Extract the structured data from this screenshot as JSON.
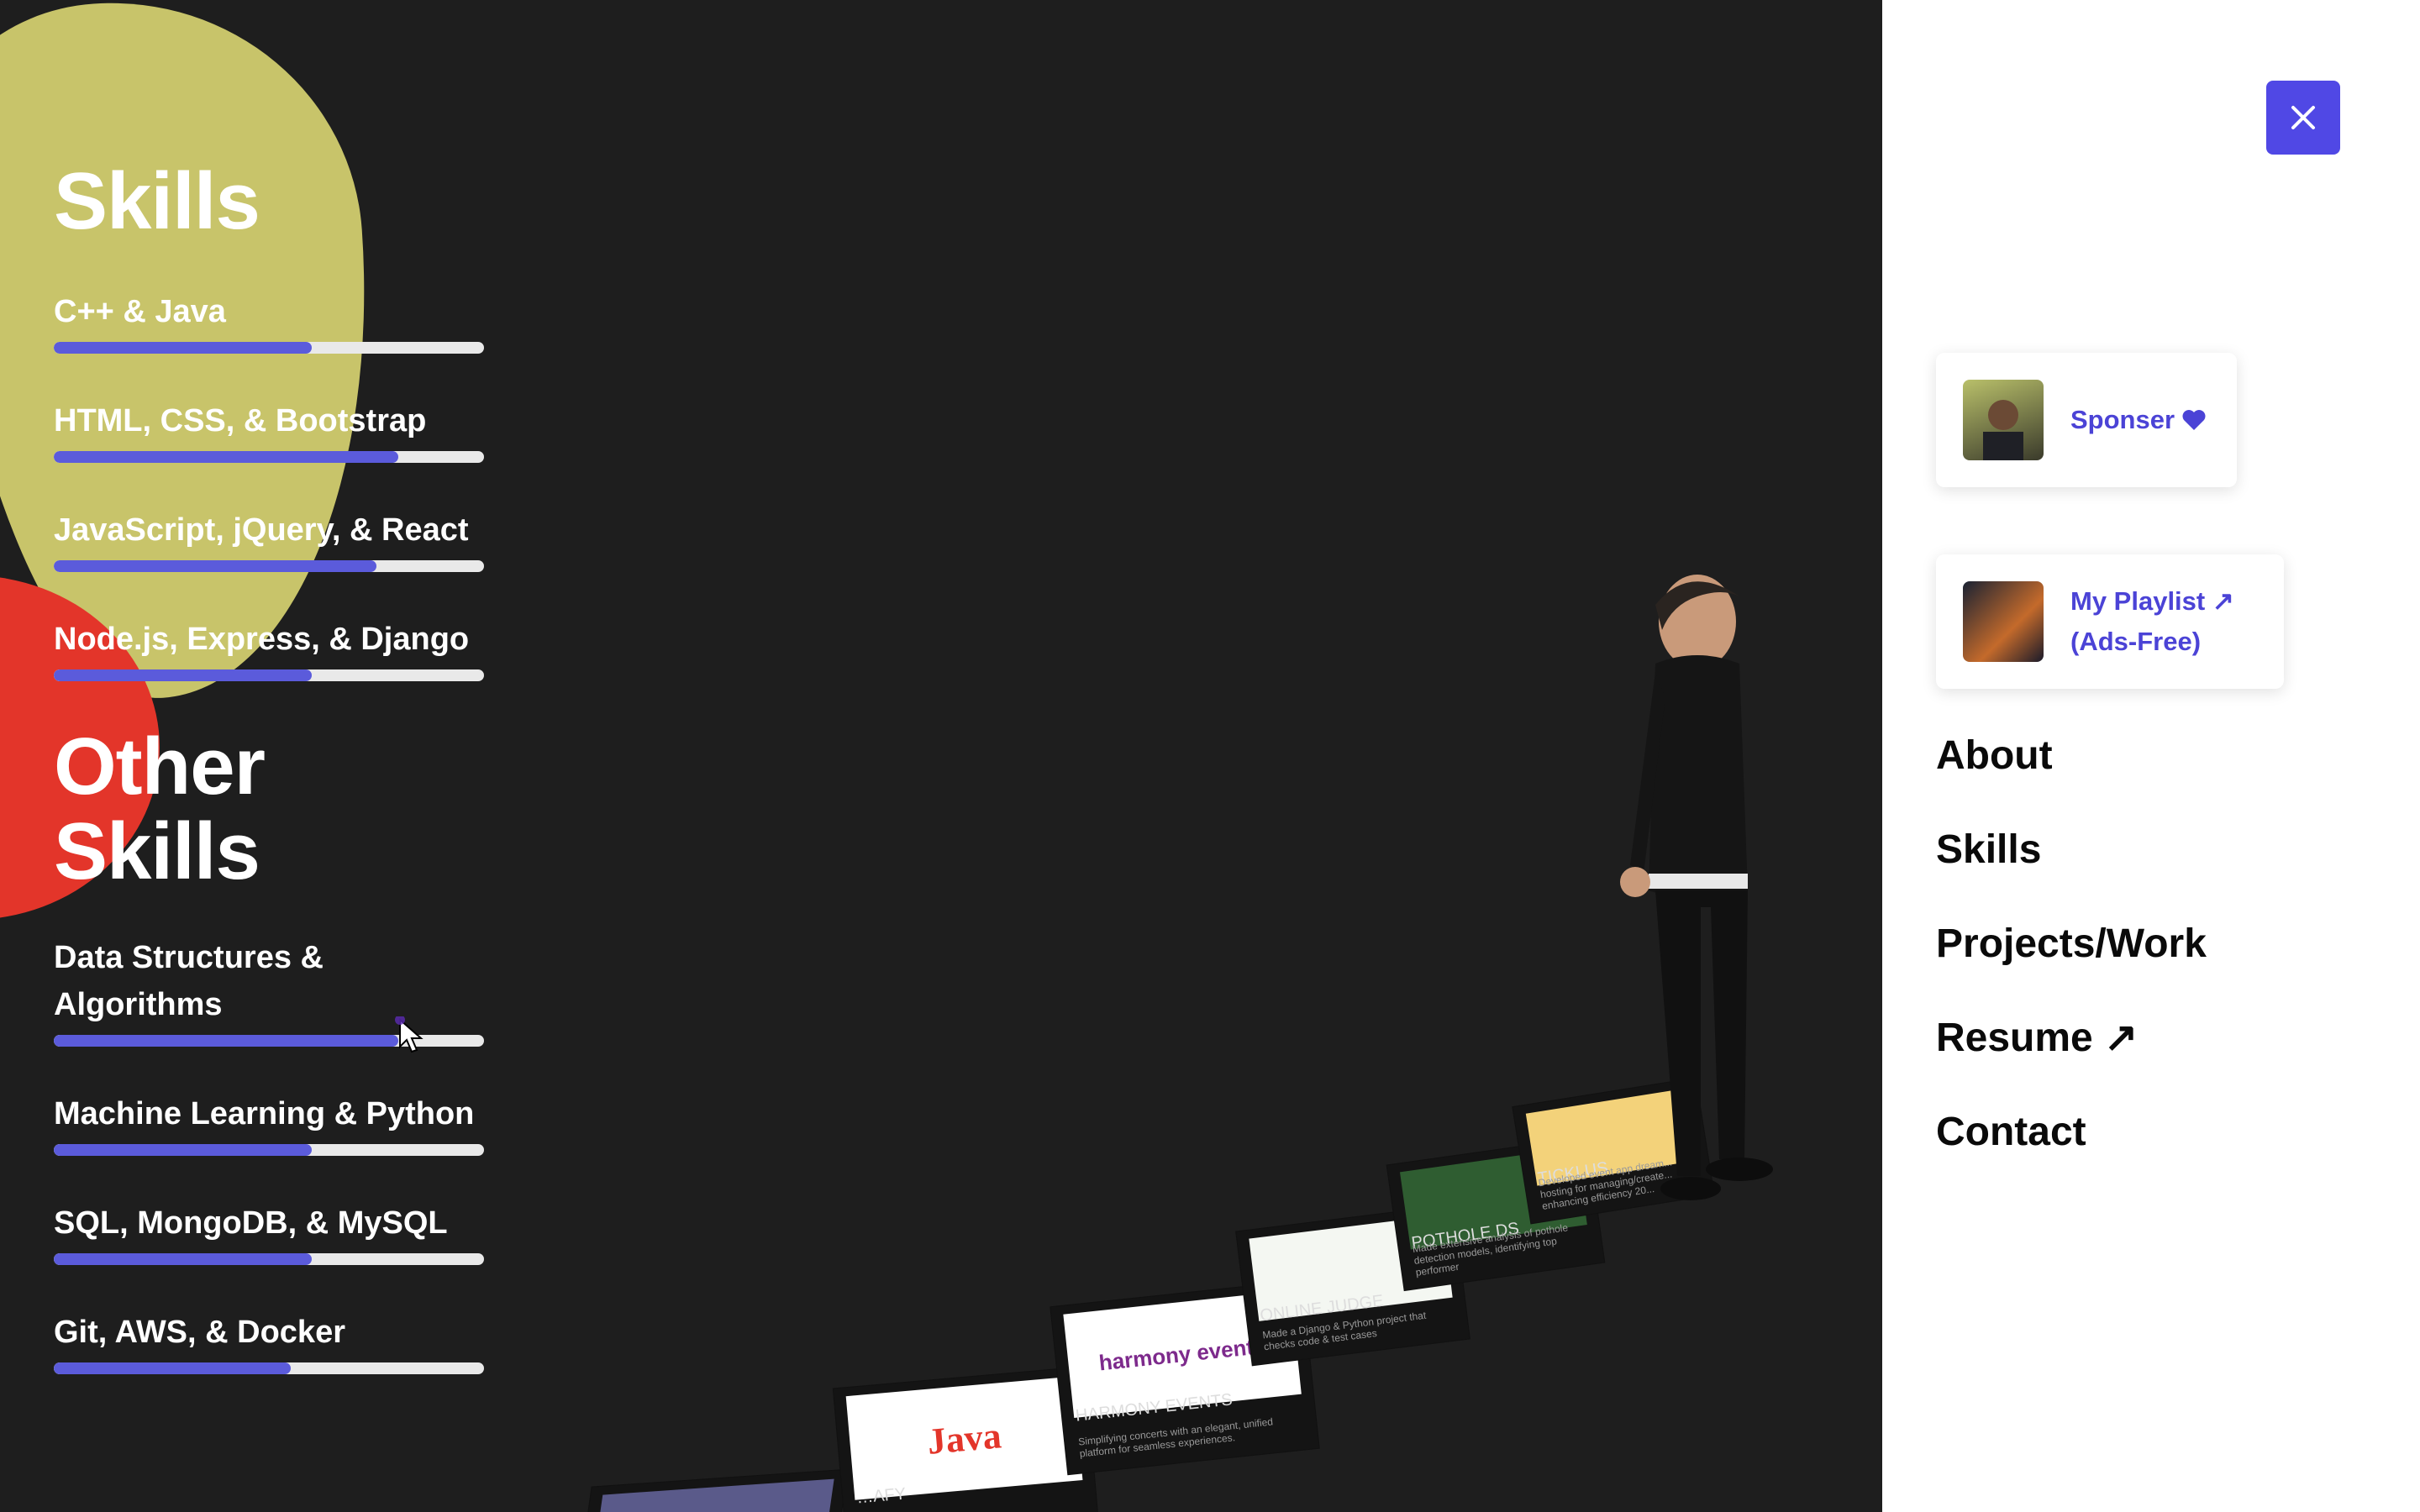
{
  "skills": {
    "title": "Skills",
    "items": [
      {
        "label": "C++ & Java",
        "level": 0.6
      },
      {
        "label": "HTML, CSS, & Bootstrap",
        "level": 0.8
      },
      {
        "label": "JavaScript, jQuery, & React",
        "level": 0.75
      },
      {
        "label": "Node.js, Express, & Django",
        "level": 0.6
      }
    ]
  },
  "other_skills": {
    "title": "Other Skills",
    "items": [
      {
        "label": "Data Structures & Algorithms",
        "level": 0.8
      },
      {
        "label": "Machine Learning & Python",
        "level": 0.6
      },
      {
        "label": "SQL, MongoDB, & MySQL",
        "level": 0.6
      },
      {
        "label": "Git, AWS, & Docker",
        "level": 0.55
      }
    ]
  },
  "projects": [
    {
      "title": "",
      "desc": ""
    },
    {
      "title": "…AFY",
      "desc": "",
      "logo": "Java"
    },
    {
      "title": "HARMONY EVENTS",
      "desc": "Simplifying concerts with an elegant, unified platform for seamless experiences.",
      "logo": "harmony events"
    },
    {
      "title": "ONLINE JUDGE",
      "desc": "Made a Django & Python project that checks code & test cases"
    },
    {
      "title": "POTHOLE DS",
      "desc": "Made extensive analysis of pothole detection models, identifying top performer"
    },
    {
      "title": "TICKLUS",
      "desc": "Developed event app dream... hosting for managing/create... enhancing efficiency 20..."
    }
  ],
  "menu": {
    "sponsor_label": "Sponser",
    "playlist_label_1": "My Playlist ↗",
    "playlist_label_2": "(Ads-Free)",
    "links": [
      "About",
      "Skills",
      "Projects/Work",
      "Resume ↗",
      "Contact"
    ]
  },
  "colors": {
    "accent": "#5048e5",
    "bar_fill": "#5b5bdb",
    "blob_yellow": "#c8c46a",
    "blob_red": "#e3352a"
  },
  "icons": {
    "close": "close-icon",
    "heart": "heart-icon",
    "cursor": "mouse-cursor-icon"
  }
}
